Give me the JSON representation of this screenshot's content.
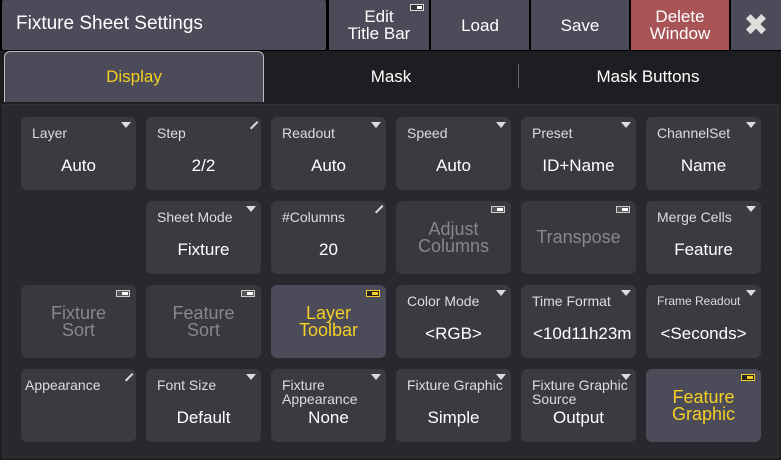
{
  "window": {
    "title": "Fixture Sheet Settings"
  },
  "header": {
    "edit_title_bar": "Edit\nTitle Bar",
    "load": "Load",
    "save": "Save",
    "delete_window": "Delete\nWindow",
    "close": "✖"
  },
  "tabs": {
    "display": "Display",
    "mask": "Mask",
    "mask_buttons": "Mask Buttons",
    "active": "Display"
  },
  "settings": {
    "layer": {
      "label": "Layer",
      "value": "Auto"
    },
    "step": {
      "label": "Step",
      "value": "2/2"
    },
    "readout": {
      "label": "Readout",
      "value": "Auto"
    },
    "speed": {
      "label": "Speed",
      "value": "Auto"
    },
    "preset": {
      "label": "Preset",
      "value": "ID+Name"
    },
    "channelset": {
      "label": "ChannelSet",
      "value": "Name"
    },
    "sheet_mode": {
      "label": "Sheet Mode",
      "value": "Fixture"
    },
    "columns": {
      "label": "#Columns",
      "value": "20"
    },
    "adjust_columns": {
      "label": "Adjust\nColumns"
    },
    "transpose": {
      "label": "Transpose"
    },
    "merge_cells": {
      "label": "Merge Cells",
      "value": "Feature"
    },
    "fixture_sort": {
      "label": "Fixture\nSort"
    },
    "feature_sort": {
      "label": "Feature\nSort"
    },
    "layer_toolbar": {
      "label": "Layer\nToolbar"
    },
    "color_mode": {
      "label": "Color Mode",
      "value": "<RGB>"
    },
    "time_format": {
      "label": "Time Format",
      "value": "<10d11h23m"
    },
    "frame_readout": {
      "label": "Frame Readout",
      "value": "<Seconds>"
    },
    "appearance": {
      "label": "Appearance"
    },
    "font_size": {
      "label": "Font Size",
      "value": "Default"
    },
    "fixture_appearance": {
      "label": "Fixture\nAppearance",
      "value": "None"
    },
    "fixture_graphic": {
      "label": "Fixture Graphic",
      "value": "Simple"
    },
    "fixture_graphic_source": {
      "label": "Fixture Graphic\nSource",
      "value": "Output"
    },
    "feature_graphic": {
      "label": "Feature\nGraphic"
    }
  },
  "colors": {
    "accent": "#f5cf23",
    "delete": "#a85457",
    "button": "#4b4b59"
  }
}
